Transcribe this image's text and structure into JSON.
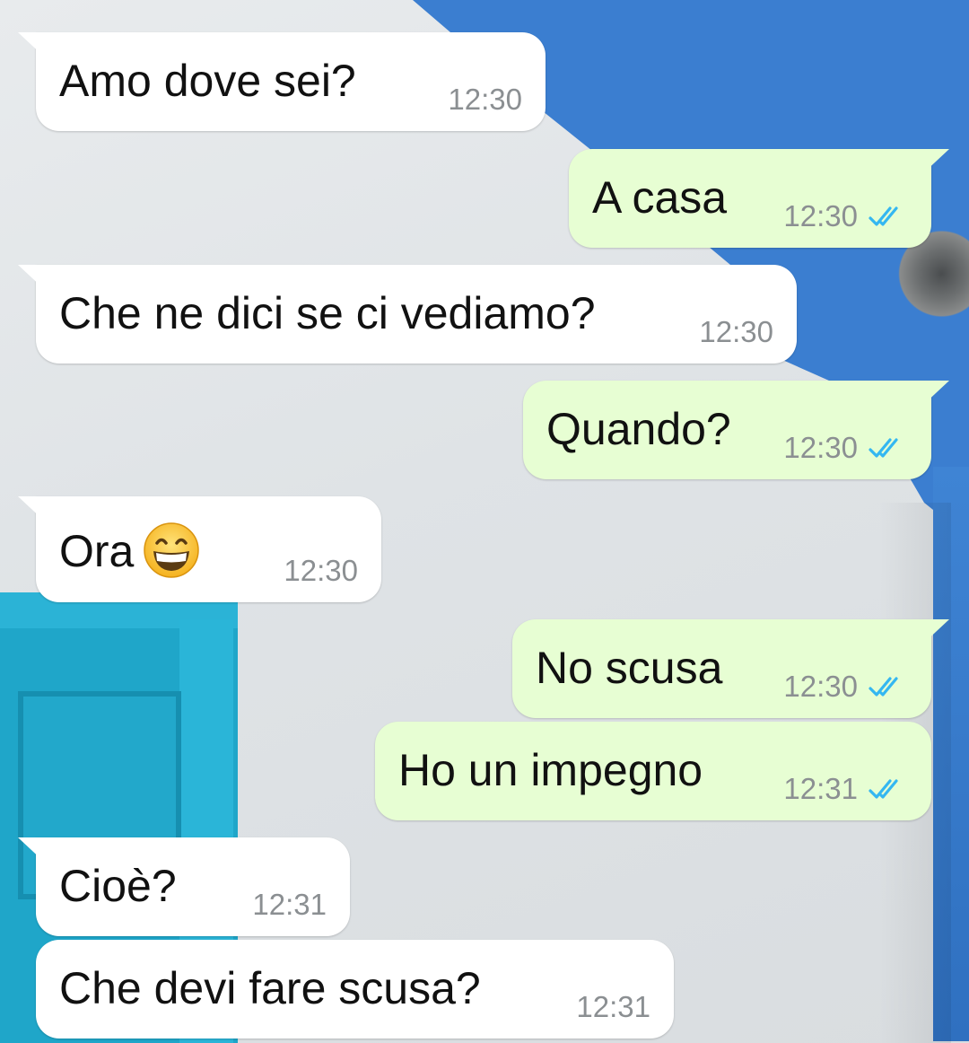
{
  "messages": [
    {
      "direction": "in",
      "text": "Amo dove sei?",
      "time": "12:30",
      "ticks": false,
      "first": true
    },
    {
      "direction": "out",
      "text": "A casa",
      "time": "12:30",
      "ticks": true,
      "first": true
    },
    {
      "direction": "in",
      "text": "Che ne dici se ci vediamo?",
      "time": "12:30",
      "ticks": false,
      "first": true
    },
    {
      "direction": "out",
      "text": "Quando?",
      "time": "12:30",
      "ticks": true,
      "first": true
    },
    {
      "direction": "in",
      "text": "Ora",
      "time": "12:30",
      "ticks": false,
      "first": true,
      "emoji": "grinning-face-with-smiling-eyes-icon"
    },
    {
      "direction": "out",
      "text": "No scusa",
      "time": "12:30",
      "ticks": true,
      "first": true
    },
    {
      "direction": "out",
      "text": "Ho un impegno",
      "time": "12:31",
      "ticks": true,
      "first": false
    },
    {
      "direction": "in",
      "text": "Cioè?",
      "time": "12:31",
      "ticks": false,
      "first": true
    },
    {
      "direction": "in",
      "text": "Che devi fare scusa?",
      "time": "12:31",
      "ticks": false,
      "first": false
    }
  ],
  "icons": {
    "read_ticks": "double-check-read-icon",
    "read_ticks_color": "#34b7f1"
  },
  "colors": {
    "incoming_bubble": "#ffffff",
    "outgoing_bubble": "#e7fed3",
    "time_text": "#8b8f92"
  }
}
